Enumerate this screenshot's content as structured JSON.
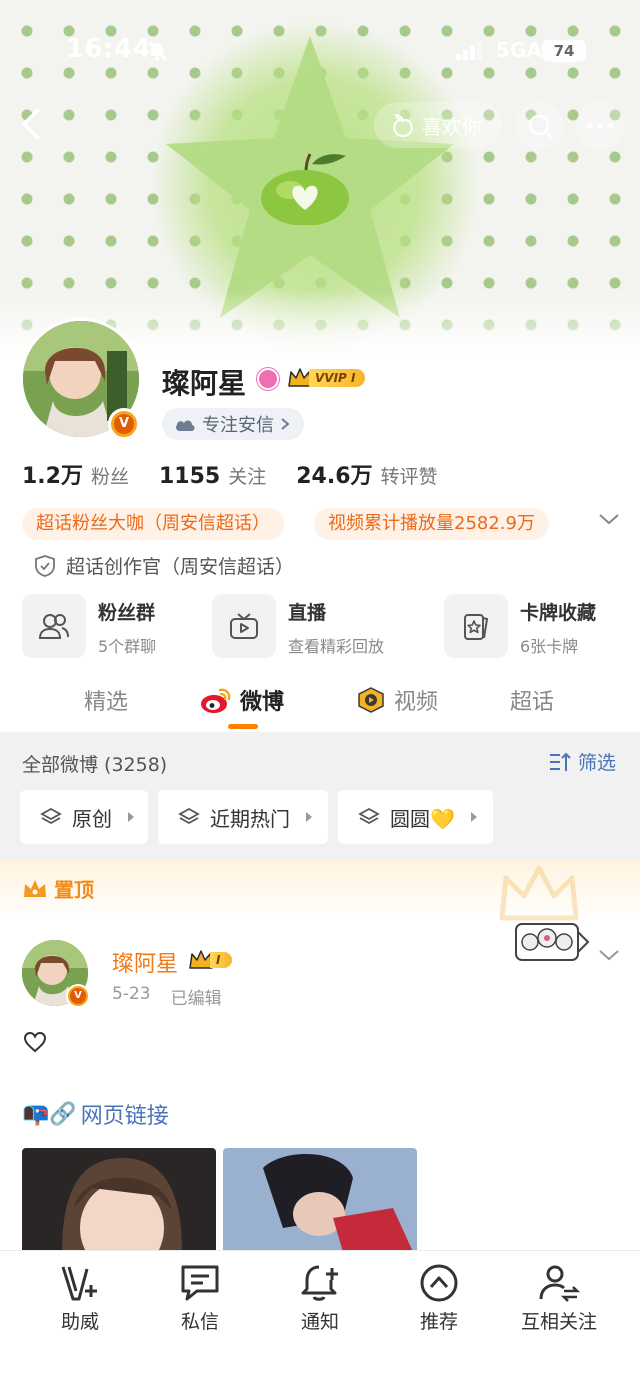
{
  "status_bar": {
    "time": "16:44",
    "network": "5GA",
    "battery": "74"
  },
  "top_nav": {
    "like_label": "喜欢你"
  },
  "profile": {
    "name": "璨阿星",
    "vip_tag": "VVIP I",
    "focus_label": "专注安信",
    "stats": [
      {
        "num": "1.2万",
        "label": "粉丝"
      },
      {
        "num": "1155",
        "label": "关注"
      },
      {
        "num": "24.6万",
        "label": "转评赞"
      }
    ],
    "tags": [
      "超话粉丝大咖（周安信超话）",
      "视频累计播放量2582.9万"
    ],
    "creator_label": "超话创作官（周安信超话）"
  },
  "services": [
    {
      "title": "粉丝群",
      "sub": "5个群聊",
      "icon": "fans-group-icon"
    },
    {
      "title": "直播",
      "sub": "查看精彩回放",
      "icon": "live-tv-icon"
    },
    {
      "title": "卡牌收藏",
      "sub": "6张卡牌",
      "icon": "card-collection-icon"
    }
  ],
  "tabs": [
    {
      "label": "精选",
      "active": false
    },
    {
      "label": "微博",
      "active": true
    },
    {
      "label": "视频",
      "active": false
    },
    {
      "label": "超话",
      "active": false
    }
  ],
  "feed": {
    "all_count": "全部微博 (3258)",
    "filter_label": "筛选",
    "chips": [
      "原创",
      "近期热门",
      "圆圆💛"
    ]
  },
  "pinned": {
    "label": "置顶",
    "author": "璨阿星",
    "vip_tag": "I",
    "date": "5-23",
    "edited": "已编辑",
    "link_text": "网页链接",
    "link_emoji": "📭🔗"
  },
  "bottom_bar": [
    {
      "label": "助威",
      "icon": "cheer-v-icon"
    },
    {
      "label": "私信",
      "icon": "message-icon"
    },
    {
      "label": "通知",
      "icon": "bell-plus-icon"
    },
    {
      "label": "推荐",
      "icon": "recommend-icon"
    },
    {
      "label": "互相关注",
      "icon": "mutual-follow-icon"
    }
  ],
  "colors": {
    "accent": "#ff8200",
    "link": "#4a74b8",
    "tag_text": "#ec6a1b",
    "tag_bg": "#fff1e6"
  }
}
